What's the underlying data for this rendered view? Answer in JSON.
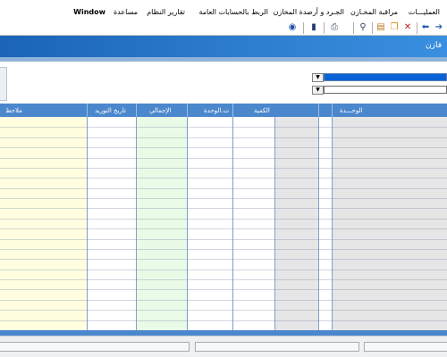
{
  "menu": [
    "العمليـــات",
    "مراقبة المخـازن",
    "الجـرد و أرصدة المخازن",
    "الربط بالحسابات العامة",
    "تقارير النظام",
    "مساعدة",
    "Window"
  ],
  "toolbar_icons": [
    "undo-icon",
    "redo-icon",
    "cut-icon",
    "copy-icon",
    "paste-icon",
    "find-icon",
    "print-icon",
    "exit-door-icon",
    "help-icon"
  ],
  "window": {
    "title": "فازن"
  },
  "grid": {
    "headers": [
      "الوحـــدة",
      "الكمية",
      "ت.الوحدة",
      "الإجمالي",
      "تاريخ التوريد",
      "ملاحظ"
    ],
    "row_count": 21
  },
  "colors": {
    "title_bar": "#2f7fd0",
    "grid_header": "#4b87cc",
    "total_column": "#e9fbe6",
    "notes_column": "#ffffe0",
    "unit_column": "#e6e6e6",
    "selected_combo": "#0a63d6"
  }
}
